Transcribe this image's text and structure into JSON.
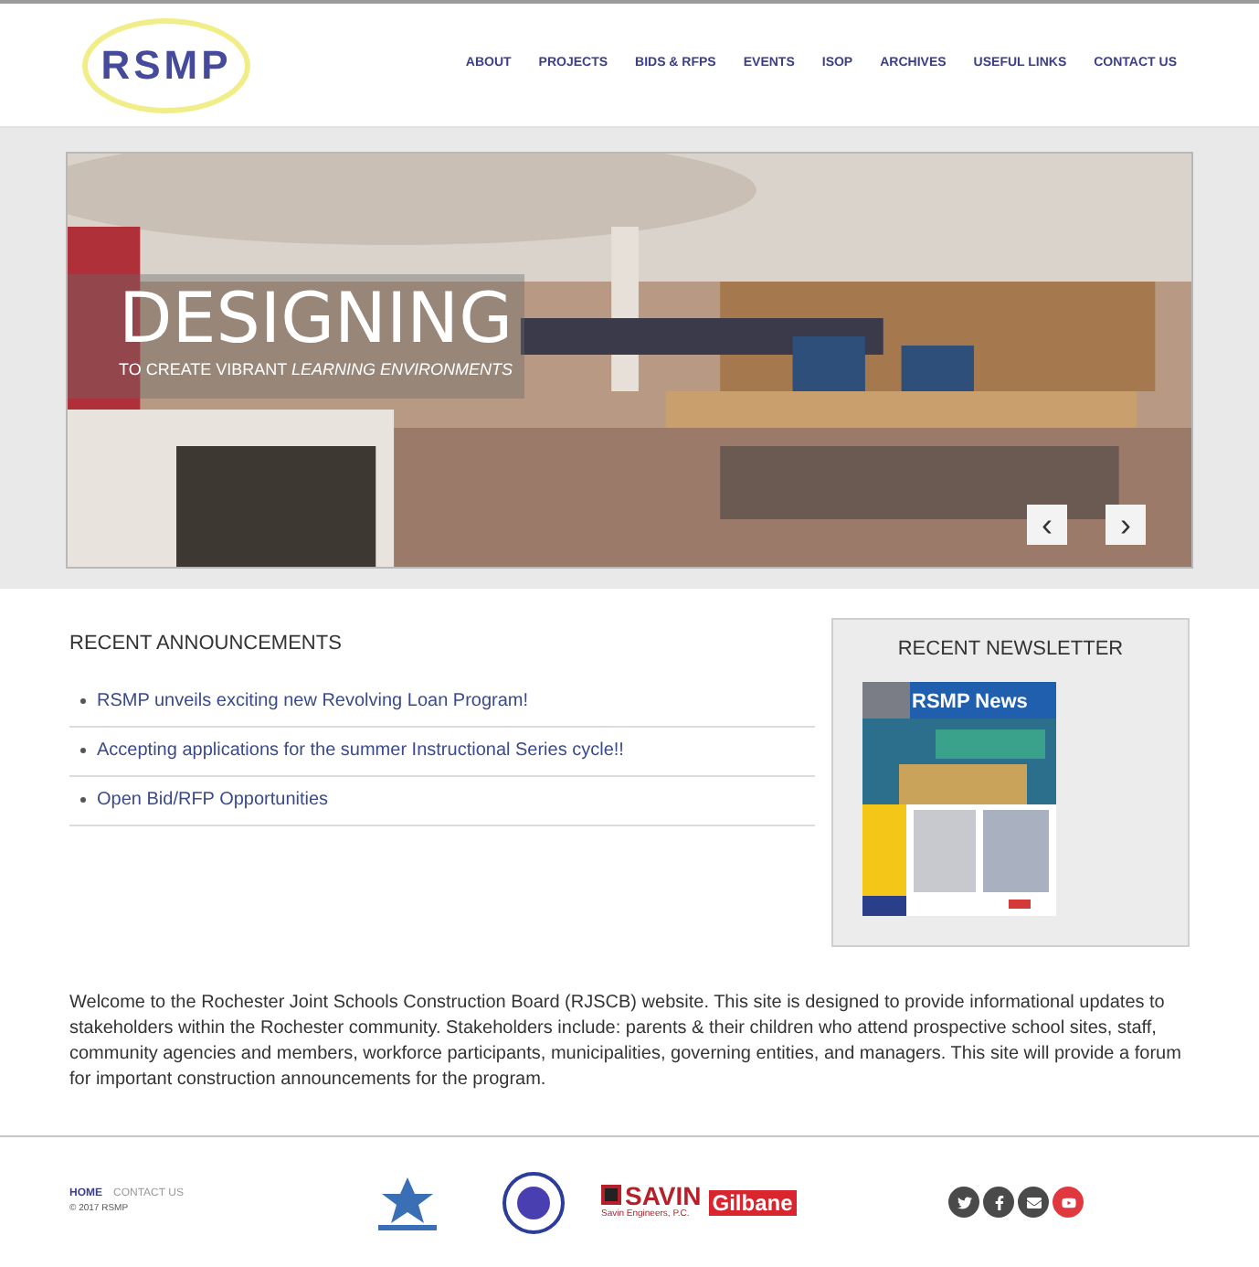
{
  "header": {
    "logo": "RSMP",
    "nav": [
      {
        "label": "ABOUT"
      },
      {
        "label": "PROJECTS"
      },
      {
        "label": "BIDS & RFPS"
      },
      {
        "label": "EVENTS"
      },
      {
        "label": "ISOP"
      },
      {
        "label": "ARCHIVES"
      },
      {
        "label": "USEFUL LINKS"
      },
      {
        "label": "CONTACT US"
      }
    ]
  },
  "hero": {
    "headline": "DESIGNING",
    "tagline": "TO CREATE VIBRANT *LEARNING ENVIRONMENTS*",
    "prev": "‹",
    "next": "›"
  },
  "announcements": {
    "title": "RECENT ANNOUNCEMENTS",
    "items": [
      "RSMP unveils exciting new Revolving Loan Program!",
      "Accepting applications for the summer Instructional Series cycle!!",
      "Open Bid/RFP Opportunities"
    ]
  },
  "newsletter": {
    "title": "RECENT NEWSLETTER",
    "cover_title": "RSMP News"
  },
  "intro": "Welcome to the Rochester Joint Schools Construction Board (RJSCB) website. This site is designed to provide informational updates to stakeholders within the Rochester community. Stakeholders include: parents & their children who attend prospective school sites, staff, community agencies and members, workforce participants, municipalities, governing entities, and managers. This site will provide a forum for important construction announcements for the program.",
  "footer": {
    "links": [
      {
        "label": "HOME",
        "selected": true
      },
      {
        "label": "CONTACT US",
        "selected": false
      }
    ],
    "copyright": "© 2017 RSMP",
    "partners": {
      "savin": "SAVIN",
      "savin_sub": "Savin Engineers, P.C.",
      "gilbane": "Gilbane"
    },
    "social": [
      {
        "kind": "twitter",
        "color": "#4a4a4a"
      },
      {
        "kind": "facebook",
        "color": "#4a4a4a"
      },
      {
        "kind": "mail",
        "color": "#4a4a4a"
      },
      {
        "kind": "youtube",
        "color": "#e0383e"
      }
    ]
  }
}
